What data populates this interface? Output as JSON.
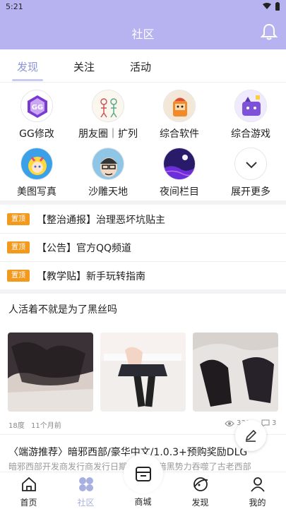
{
  "status_bar": {
    "time": "5:21"
  },
  "header": {
    "title": "社区"
  },
  "tabs": [
    {
      "label": "发现",
      "active": true
    },
    {
      "label": "关注",
      "active": false
    },
    {
      "label": "活动",
      "active": false
    }
  ],
  "categories": [
    {
      "label": "GG修改",
      "icon": "gg-logo-icon"
    },
    {
      "label": "朋友圈｜扩列",
      "icon": "sketch-people-icon"
    },
    {
      "label": "综合软件",
      "icon": "cartoon-avatar-icon"
    },
    {
      "label": "综合游戏",
      "icon": "game-character-icon"
    },
    {
      "label": "美图写真",
      "icon": "anime-girl-icon"
    },
    {
      "label": "沙雕天地",
      "icon": "meme-face-icon"
    },
    {
      "label": "夜间栏目",
      "icon": "night-sky-icon"
    },
    {
      "label": "展开更多",
      "icon": "chevron-down-icon"
    }
  ],
  "pinned": {
    "badge": "置顶",
    "items": [
      {
        "text": "【整治通报】治理恶坏坑贴主"
      },
      {
        "text": "【公告】官方QQ频道"
      },
      {
        "text": "【教学贴】新手玩转指南"
      }
    ]
  },
  "post1": {
    "title": "人活着不就是为了黑丝吗",
    "author_level": "18度",
    "time": "11个月前",
    "views": "330",
    "comments": "3"
  },
  "post2": {
    "title": "〈端游推荐〉暗邪西部/豪华中文/1.0.3+预购奖励DLG",
    "subtitle": "暗邪西部开发商发行商发行日期 … 一般暗黑势力吞噬了古老西部"
  },
  "bottom_nav": [
    {
      "label": "首页",
      "icon": "home-icon"
    },
    {
      "label": "社区",
      "icon": "community-icon",
      "active": true
    },
    {
      "label": "商城",
      "icon": "shop-icon"
    },
    {
      "label": "发现",
      "icon": "discover-icon"
    },
    {
      "label": "我的",
      "icon": "profile-icon"
    }
  ],
  "colors": {
    "accent": "#b7b2f0",
    "pin": "#f29a1e",
    "active_nav": "#a8b0e0"
  }
}
